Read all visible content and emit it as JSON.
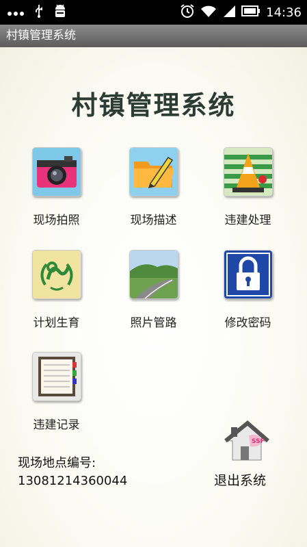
{
  "status_bar": {
    "time": "14:36"
  },
  "window": {
    "title": "村镇管理系统"
  },
  "app": {
    "title": "村镇管理系统"
  },
  "menu": [
    {
      "label": "现场拍照",
      "icon": "camera-icon"
    },
    {
      "label": "现场描述",
      "icon": "folder-pencil-icon"
    },
    {
      "label": "违建处理",
      "icon": "traffic-cone-icon"
    },
    {
      "label": "计划生育",
      "icon": "family-planning-logo-icon"
    },
    {
      "label": "照片管路",
      "icon": "road-photo-icon"
    },
    {
      "label": "修改密码",
      "icon": "lock-icon"
    },
    {
      "label": "违建记录",
      "icon": "notebook-icon"
    }
  ],
  "location": {
    "label": "现场地点编号:",
    "value": "13081214360044"
  },
  "exit": {
    "label": "退出系统",
    "icon": "house-icon"
  }
}
